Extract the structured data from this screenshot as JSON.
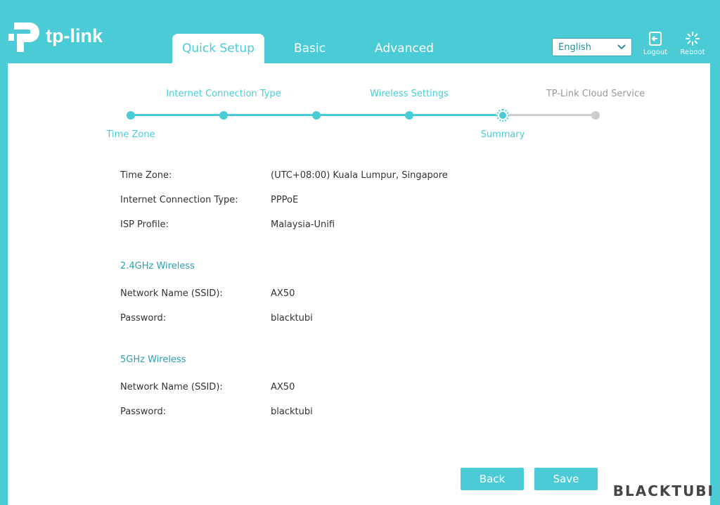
{
  "brand": {
    "logo_text": "tp-link"
  },
  "tabs": [
    {
      "label": "Quick Setup",
      "active": true
    },
    {
      "label": "Basic",
      "active": false
    },
    {
      "label": "Advanced",
      "active": false
    }
  ],
  "header": {
    "language": "English",
    "logout_label": "Logout",
    "reboot_label": "Reboot"
  },
  "steps": [
    {
      "label": "Time Zone",
      "state": "done"
    },
    {
      "label": "Internet Connection Type",
      "state": "done"
    },
    {
      "label": "",
      "state": "done"
    },
    {
      "label": "Wireless Settings",
      "state": "done"
    },
    {
      "label": "Summary",
      "state": "current"
    },
    {
      "label": "TP-Link Cloud Service",
      "state": "pending"
    }
  ],
  "summary": {
    "time_zone_label": "Time Zone:",
    "time_zone_value": "(UTC+08:00) Kuala Lumpur, Singapore",
    "conn_type_label": "Internet Connection Type:",
    "conn_type_value": "PPPoE",
    "isp_label": "ISP Profile:",
    "isp_value": "Malaysia-Unifi",
    "w24_title": "2.4GHz Wireless",
    "w24_ssid_label": "Network Name (SSID):",
    "w24_ssid_value": "AX50",
    "w24_pw_label": "Password:",
    "w24_pw_value": "blacktubi",
    "w5_title": "5GHz Wireless",
    "w5_ssid_label": "Network Name (SSID):",
    "w5_ssid_value": "AX50",
    "w5_pw_label": "Password:",
    "w5_pw_value": "blacktubi"
  },
  "buttons": {
    "back": "Back",
    "save": "Save"
  },
  "watermark": "BLACKTUBI",
  "colors": {
    "accent": "#4acbd6",
    "section_title": "#2a9fb3",
    "pending": "#cccccc"
  }
}
